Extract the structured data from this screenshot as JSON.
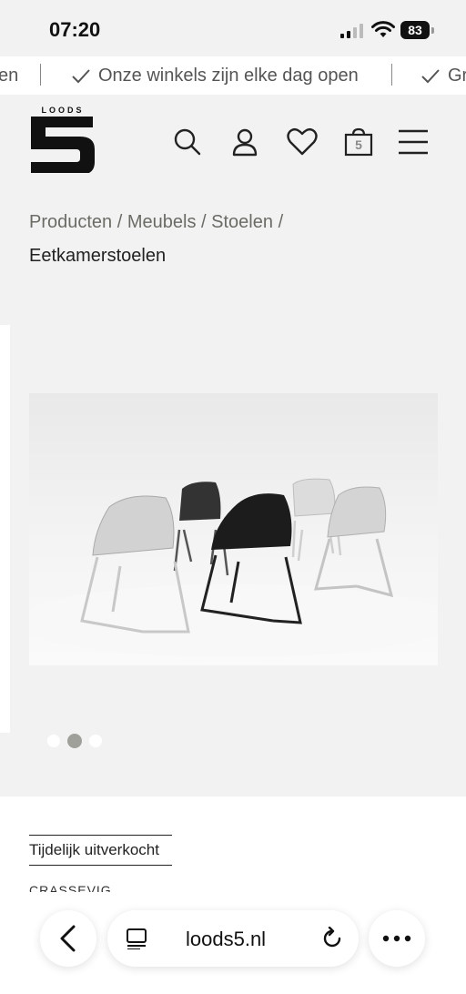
{
  "status_bar": {
    "time": "07:20",
    "battery": "83"
  },
  "ticker": {
    "left_fragment": "en",
    "message": "Onze winkels zijn elke dag open",
    "right_fragment": "Gr"
  },
  "header": {
    "logo_text": "LOODS",
    "logo_number": "5",
    "icons": [
      "search-icon",
      "account-icon",
      "heart-icon",
      "cart-icon",
      "menu-icon"
    ],
    "cart_count": "5"
  },
  "breadcrumb": {
    "items": [
      "Producten",
      "Meubels",
      "Stoelen"
    ],
    "separator": "/",
    "current": "Eetkamerstoelen"
  },
  "gallery": {
    "slide_count": 3,
    "active_slide": 2
  },
  "product": {
    "badge": "Tijdelijk uitverkocht",
    "brand_partial": "CRASSEVIG"
  },
  "browser": {
    "url": "loods5.nl"
  },
  "colors": {
    "accent_gray": "#9fa099",
    "breadcrumb": "#6b6b66",
    "bg": "#f2f2f2"
  }
}
